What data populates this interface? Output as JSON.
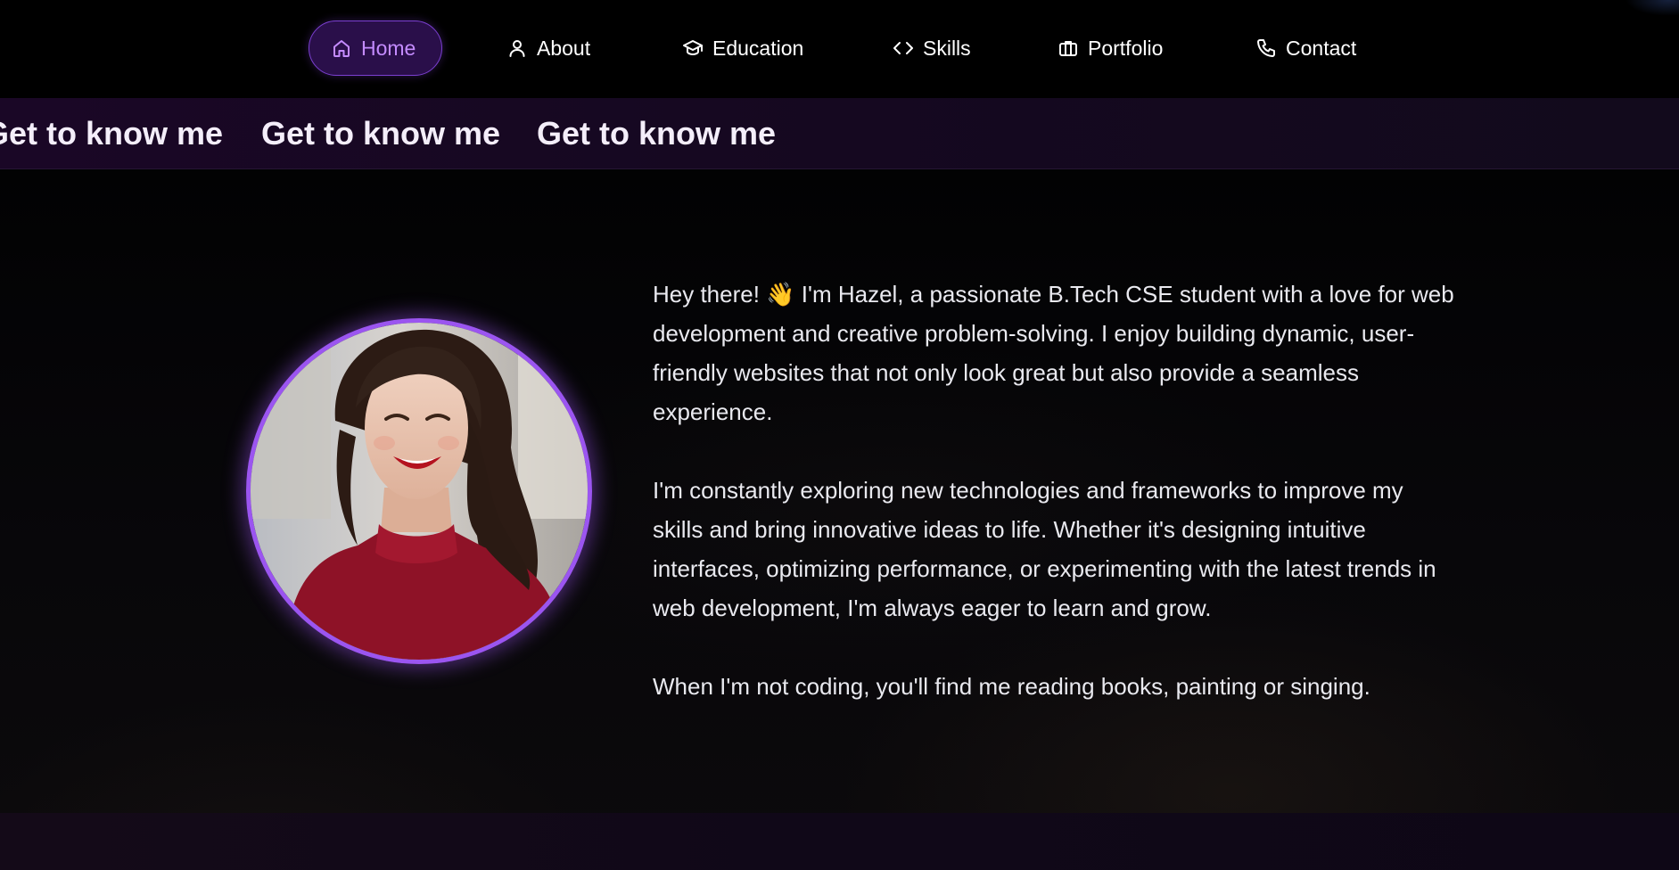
{
  "nav": {
    "items": [
      {
        "label": "Home",
        "icon": "home-icon",
        "active": true
      },
      {
        "label": "About",
        "icon": "user-icon"
      },
      {
        "label": "Education",
        "icon": "graduation-cap-icon"
      },
      {
        "label": "Skills",
        "icon": "code-icon"
      },
      {
        "label": "Portfolio",
        "icon": "briefcase-icon"
      },
      {
        "label": "Contact",
        "icon": "phone-icon"
      }
    ],
    "active_color": "#c48bff"
  },
  "marquee": {
    "items": [
      "Get to know me",
      "Get to know me",
      "Get to know me"
    ]
  },
  "about": {
    "photo_icon": "profile-photo",
    "accent_color": "#9b55f0",
    "paragraphs": [
      "Hey there! 👋 I'm Hazel, a passionate B.Tech CSE student with a love for web development and creative problem-solving. I enjoy building dynamic, user-friendly websites that not only look great but also provide a seamless experience.",
      "I'm constantly exploring new technologies and frameworks to improve my skills and bring innovative ideas to life. Whether it's designing intuitive interfaces, optimizing performance, or experimenting with the latest trends in web development, I'm always eager to learn and grow.",
      "When I'm not coding, you'll find me reading books, painting or singing."
    ]
  }
}
